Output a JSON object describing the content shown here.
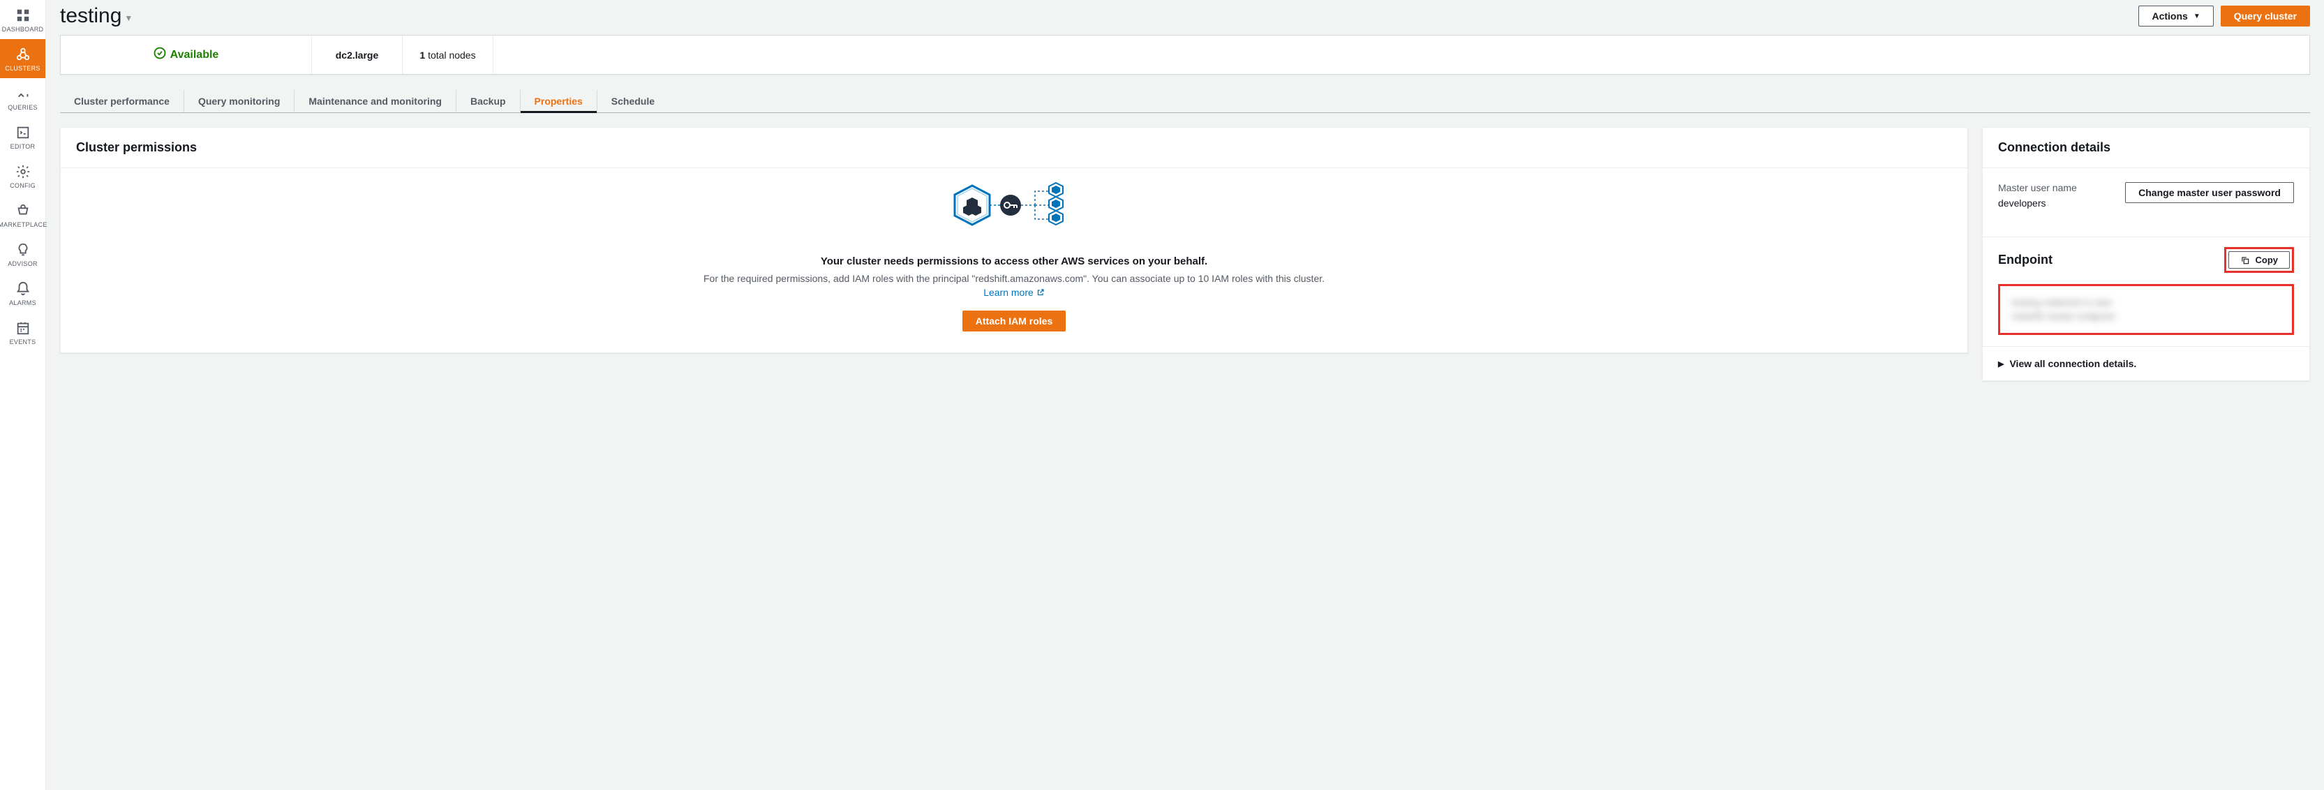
{
  "sidebar": {
    "items": [
      {
        "label": "DASHBOARD",
        "icon": "dashboard"
      },
      {
        "label": "CLUSTERS",
        "icon": "clusters",
        "active": true
      },
      {
        "label": "QUERIES",
        "icon": "queries"
      },
      {
        "label": "EDITOR",
        "icon": "editor"
      },
      {
        "label": "CONFIG",
        "icon": "config"
      },
      {
        "label": "MARKETPLACE",
        "icon": "marketplace"
      },
      {
        "label": "ADVISOR",
        "icon": "advisor"
      },
      {
        "label": "ALARMS",
        "icon": "alarms"
      },
      {
        "label": "EVENTS",
        "icon": "events"
      }
    ]
  },
  "header": {
    "title": "testing",
    "actions_label": "Actions",
    "query_cluster_label": "Query cluster"
  },
  "status": {
    "availability": "Available",
    "node_type": "dc2.large",
    "node_count": "1",
    "node_unit": "total nodes"
  },
  "tabs": [
    {
      "label": "Cluster performance"
    },
    {
      "label": "Query monitoring"
    },
    {
      "label": "Maintenance and monitoring"
    },
    {
      "label": "Backup"
    },
    {
      "label": "Properties",
      "active": true
    },
    {
      "label": "Schedule"
    }
  ],
  "permissions": {
    "panel_title": "Cluster permissions",
    "empty_title": "Your cluster needs permissions to access other AWS services on your behalf.",
    "empty_desc": "For the required permissions, add IAM roles with the principal \"redshift.amazonaws.com\". You can associate up to 10 IAM roles with this cluster.",
    "learn_more": "Learn more",
    "attach_button": "Attach IAM roles"
  },
  "connection": {
    "panel_title": "Connection details",
    "master_user_label": "Master user name",
    "master_user_value": "developers",
    "change_password_button": "Change master user password",
    "endpoint_title": "Endpoint",
    "copy_button": "Copy",
    "endpoint_value_redacted": "testing  redacted  rs  aws\nredshift  cluster  endpoint",
    "view_all": "View all connection details."
  }
}
